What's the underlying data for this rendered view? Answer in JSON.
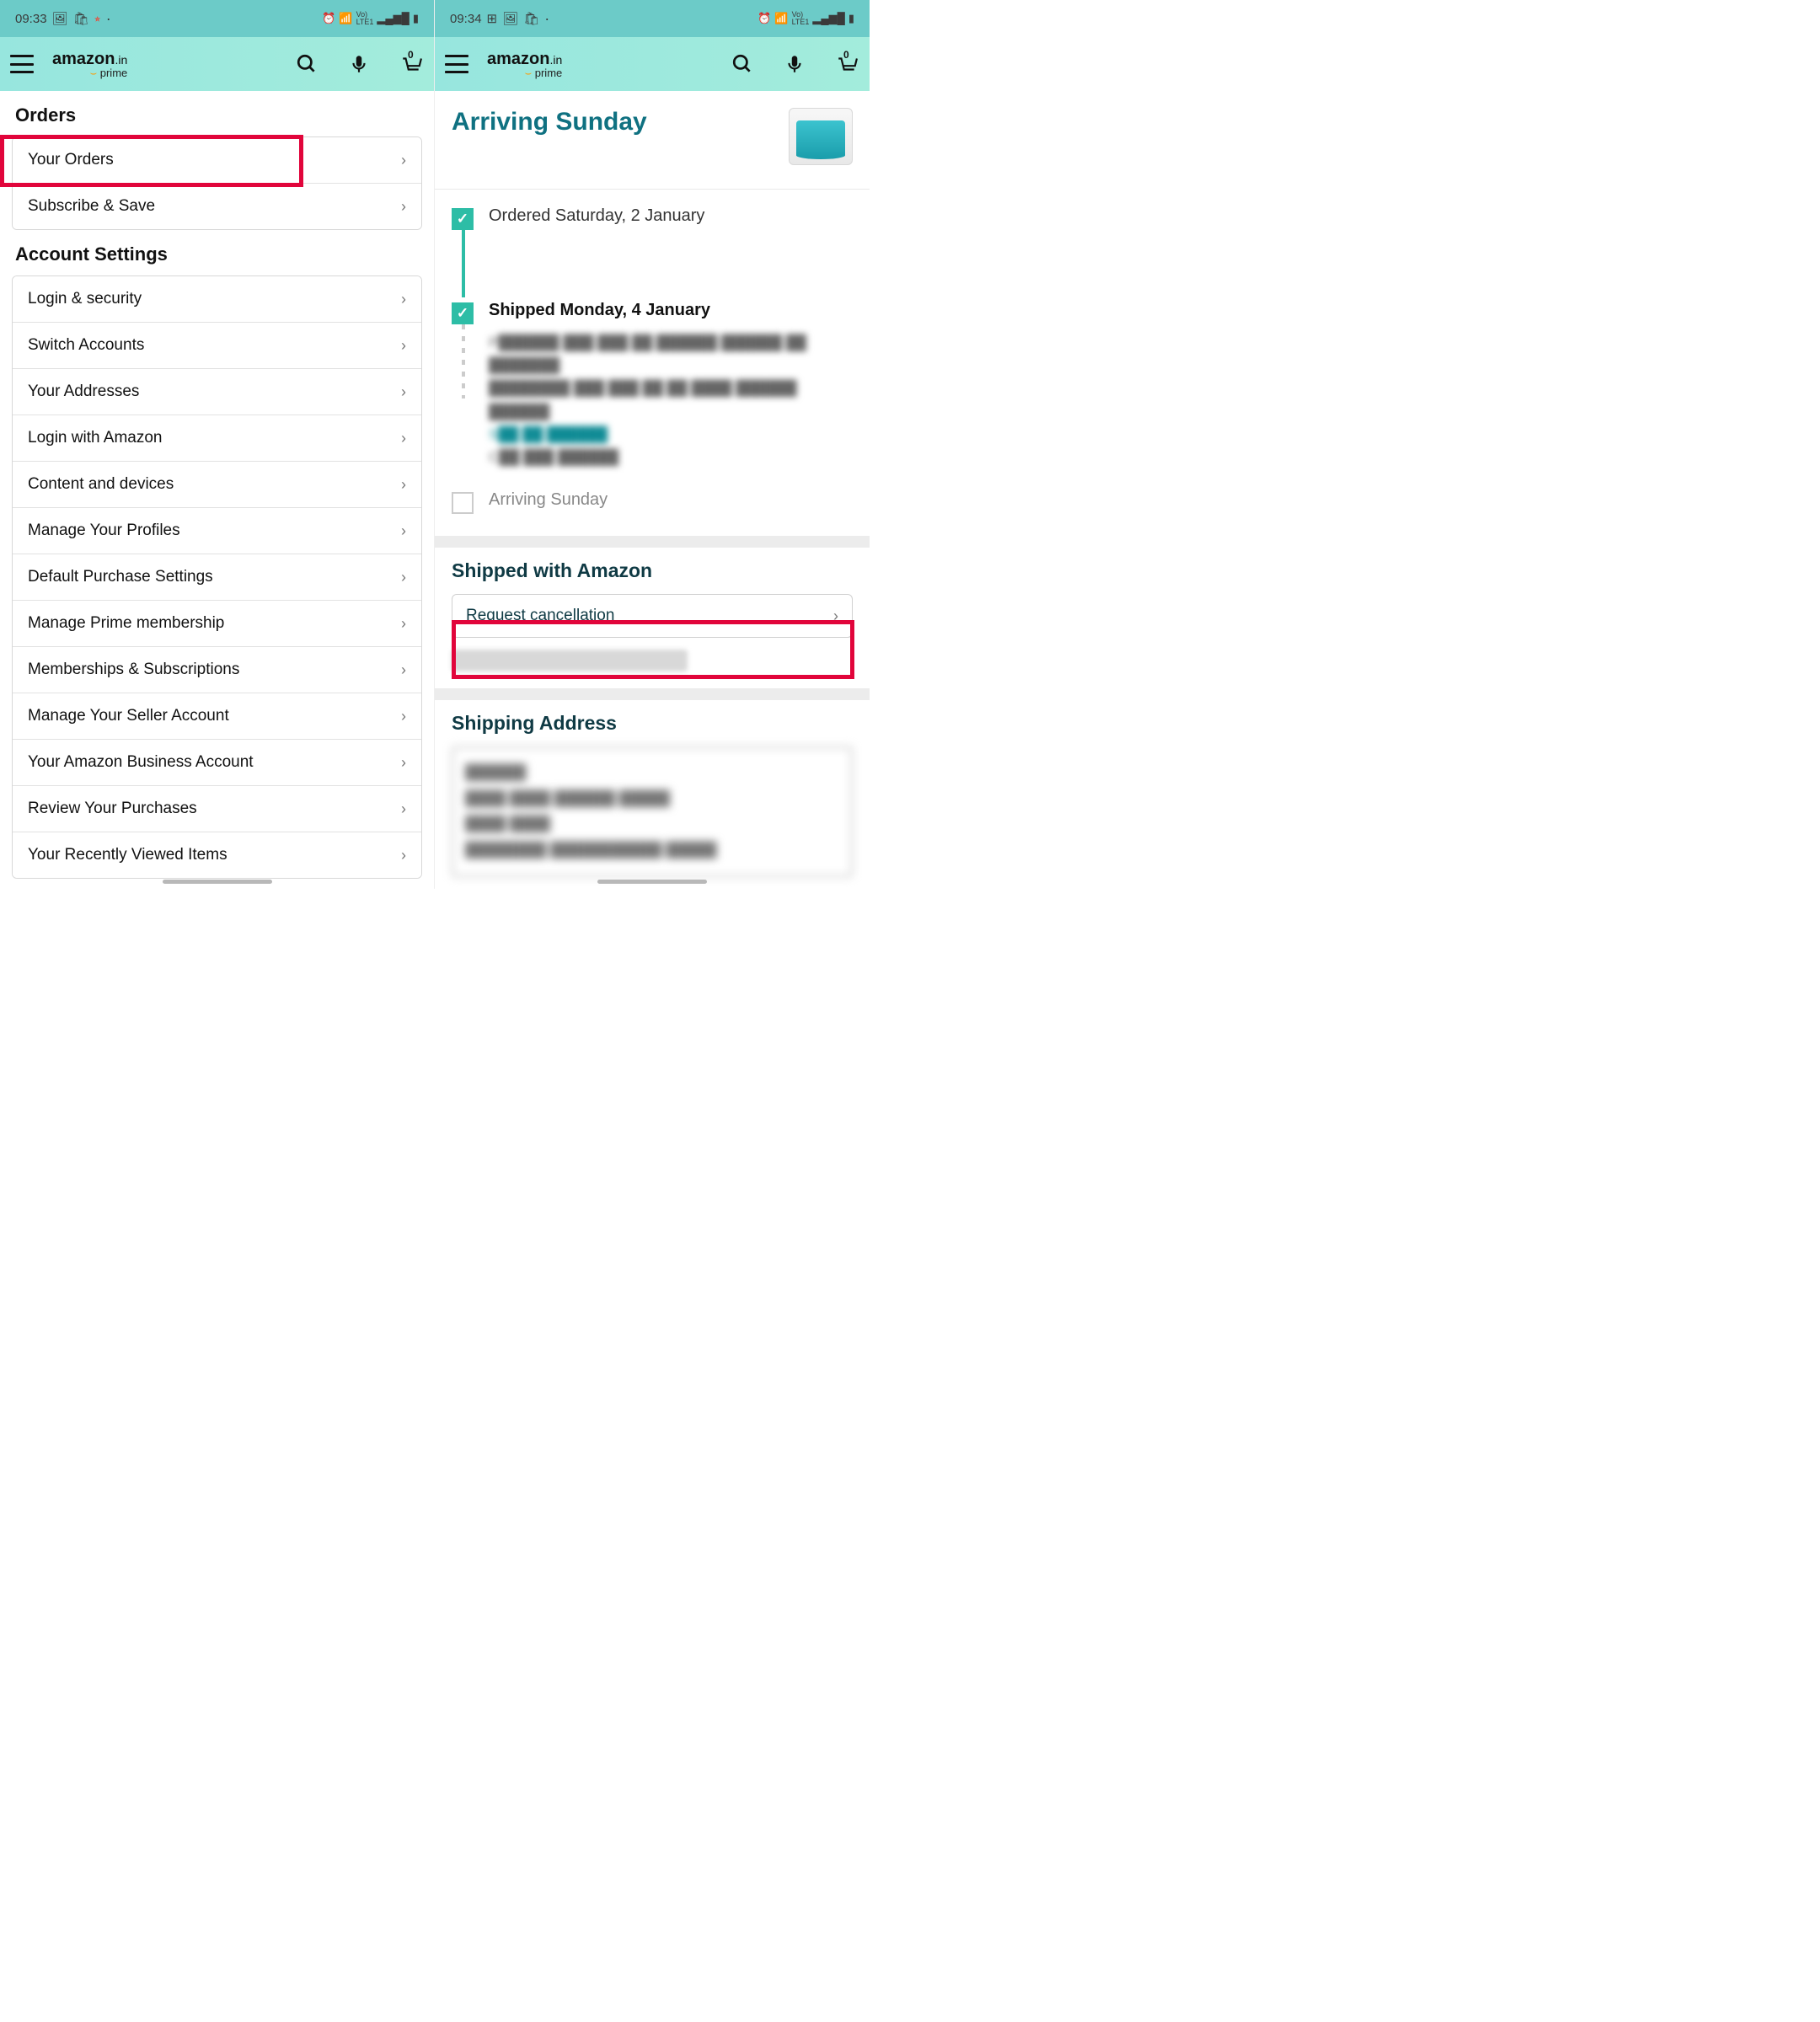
{
  "left": {
    "status": {
      "time": "09:33"
    },
    "cart_count": "0",
    "sections": {
      "orders": {
        "heading": "Orders",
        "items": [
          "Your Orders",
          "Subscribe & Save"
        ]
      },
      "account": {
        "heading": "Account Settings",
        "items": [
          "Login & security",
          "Switch Accounts",
          "Your Addresses",
          "Login with Amazon",
          "Content and devices",
          "Manage Your Profiles",
          "Default Purchase Settings",
          "Manage Prime membership",
          "Memberships & Subscriptions",
          "Manage Your Seller Account",
          "Your Amazon Business Account",
          "Review Your Purchases",
          "Your Recently Viewed Items"
        ]
      }
    }
  },
  "right": {
    "status": {
      "time": "09:34"
    },
    "cart_count": "0",
    "order_title": "Arriving Sunday",
    "timeline": {
      "ordered": "Ordered Saturday, 2 January",
      "shipped": "Shipped Monday, 4 January",
      "arriving": "Arriving Sunday"
    },
    "shipped_with": "Shipped with Amazon",
    "cancel_label": "Request cancellation",
    "shipping_address_heading": "Shipping Address"
  },
  "logo": {
    "brand": "amazon",
    "suffix": ".in",
    "sub": "prime"
  }
}
